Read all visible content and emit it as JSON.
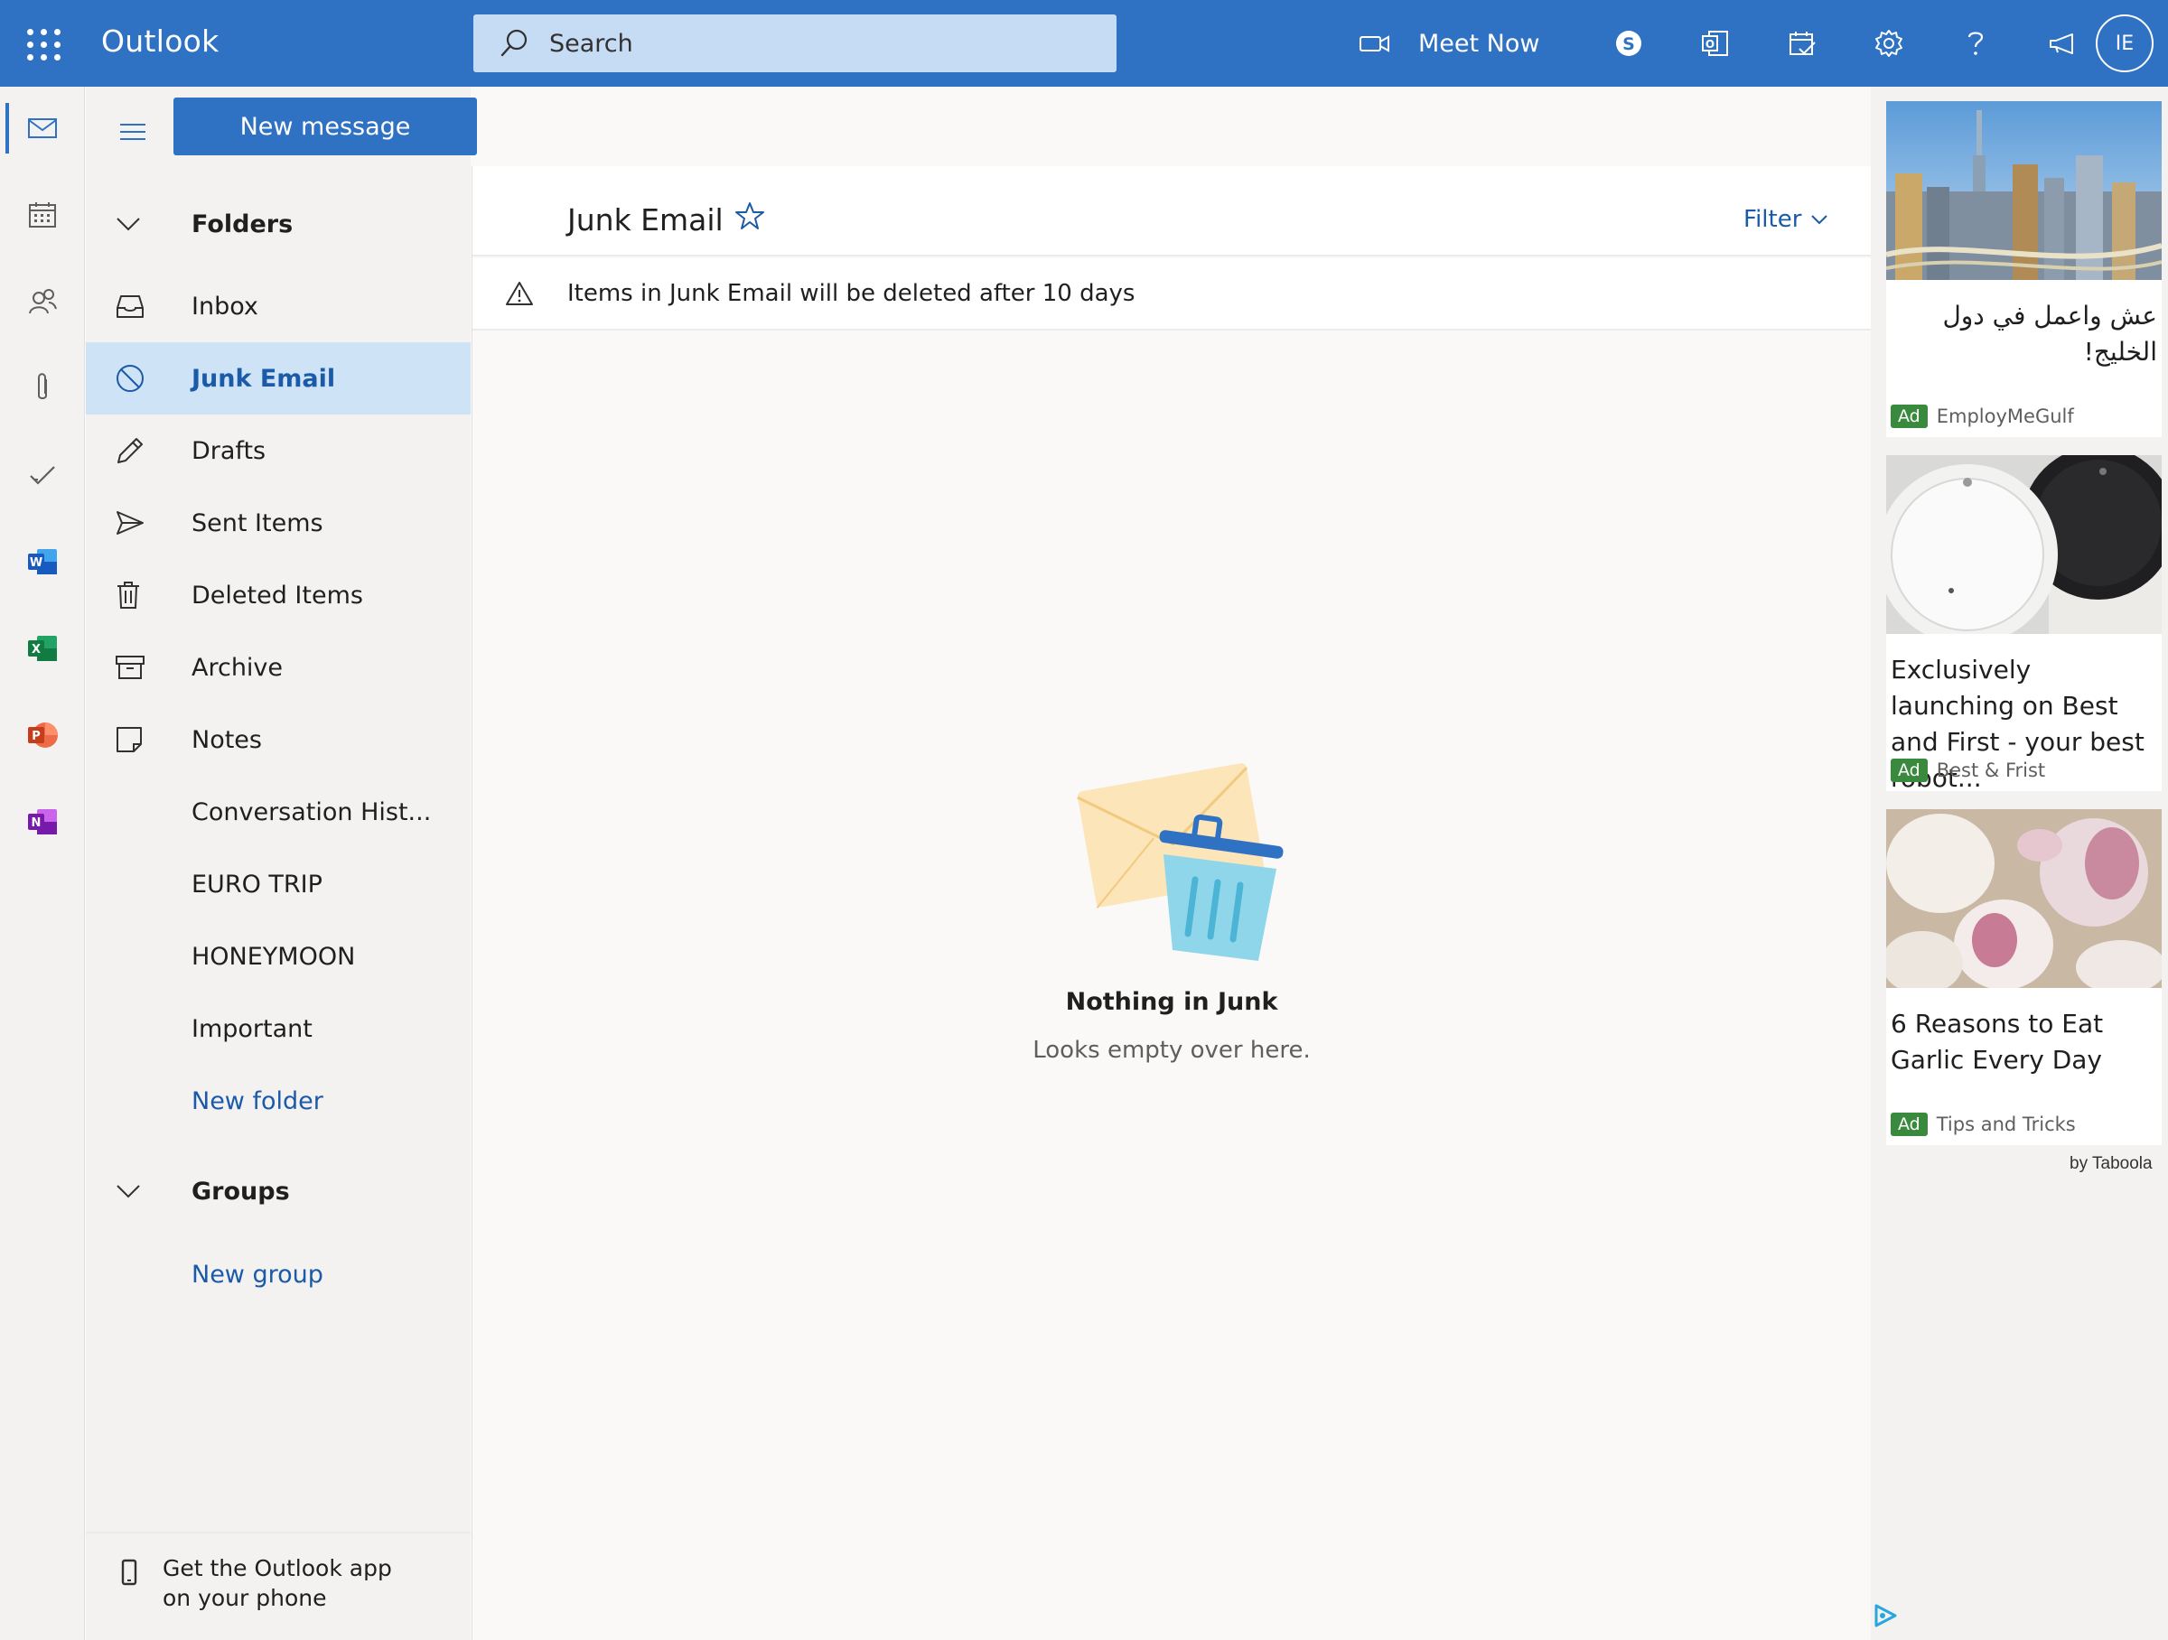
{
  "app": {
    "name": "Outlook"
  },
  "search": {
    "placeholder": "Search"
  },
  "topbar": {
    "meet_now_label": "Meet Now",
    "avatar_initials": "IE"
  },
  "toolbar": {
    "new_message_label": "New message"
  },
  "folders": {
    "header": "Folders",
    "items": [
      {
        "label": "Inbox",
        "icon": "inbox-icon"
      },
      {
        "label": "Junk Email",
        "icon": "block-icon",
        "selected": true
      },
      {
        "label": "Drafts",
        "icon": "pencil-icon"
      },
      {
        "label": "Sent Items",
        "icon": "send-icon"
      },
      {
        "label": "Deleted Items",
        "icon": "trash-icon"
      },
      {
        "label": "Archive",
        "icon": "archive-icon"
      },
      {
        "label": "Notes",
        "icon": "note-icon"
      },
      {
        "label": "Conversation Hist..."
      },
      {
        "label": "EURO TRIP"
      },
      {
        "label": "HONEYMOON"
      },
      {
        "label": "Important"
      }
    ],
    "new_folder_label": "New folder"
  },
  "groups": {
    "header": "Groups",
    "new_group_label": "New group"
  },
  "get_app": {
    "line1": "Get the Outlook app",
    "line2": "on your phone"
  },
  "message_list": {
    "title": "Junk Email",
    "filter_label": "Filter",
    "notice": "Items in Junk Email will be deleted after 10 days",
    "empty_title": "Nothing in Junk",
    "empty_subtitle": "Looks empty over here."
  },
  "ads": {
    "items": [
      {
        "title": "عش واعمل في دول الخليج!",
        "badge": "Ad",
        "source": "EmployMeGulf"
      },
      {
        "title": "Exclusively launching on Best and First - your best robot...",
        "badge": "Ad",
        "source": "Best & Frist"
      },
      {
        "title": "6 Reasons to Eat Garlic Every Day",
        "badge": "Ad",
        "source": "Tips and Tricks"
      }
    ],
    "provider": "by Taboola"
  },
  "colors": {
    "brand_blue": "#2f72c4",
    "selected_folder_bg": "#cfe3f7",
    "link_blue": "#1b5aa8",
    "ad_badge_green": "#3a8a3e"
  }
}
